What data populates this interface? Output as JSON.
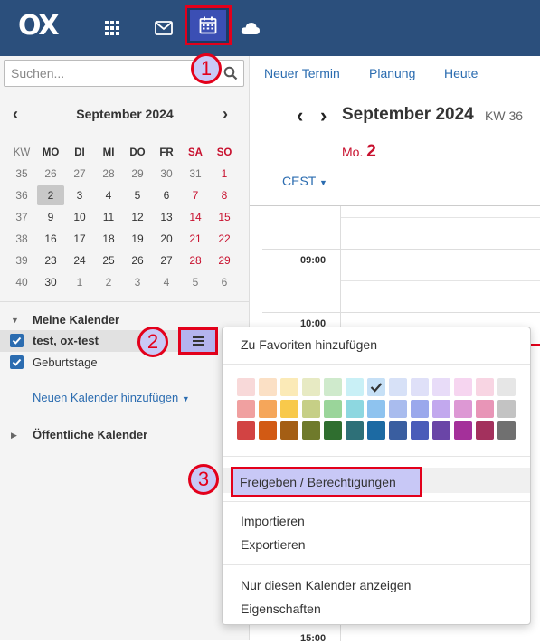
{
  "topbar": {
    "logo": "OX",
    "icons": [
      "apps-grid-icon",
      "mail-icon",
      "calendar-icon",
      "cloud-icon"
    ]
  },
  "markers": [
    "1",
    "2",
    "3"
  ],
  "search": {
    "placeholder": "Suchen..."
  },
  "mini_calendar": {
    "title": "September 2024",
    "headers": [
      "KW",
      "MO",
      "DI",
      "MI",
      "DO",
      "FR",
      "SA",
      "SO"
    ],
    "weeks": [
      [
        "35",
        "26",
        "27",
        "28",
        "29",
        "30",
        "31",
        "1"
      ],
      [
        "36",
        "2",
        "3",
        "4",
        "5",
        "6",
        "7",
        "8"
      ],
      [
        "37",
        "9",
        "10",
        "11",
        "12",
        "13",
        "14",
        "15"
      ],
      [
        "38",
        "16",
        "17",
        "18",
        "19",
        "20",
        "21",
        "22"
      ],
      [
        "39",
        "23",
        "24",
        "25",
        "26",
        "27",
        "28",
        "29"
      ],
      [
        "40",
        "30",
        "1",
        "2",
        "3",
        "4",
        "5",
        "6"
      ]
    ]
  },
  "calendars": {
    "my_title": "Meine Kalender",
    "items": [
      {
        "label": "test, ox-test",
        "checked": true
      },
      {
        "label": "Geburtstage",
        "checked": true
      }
    ],
    "add_link": "Neuen Kalender hinzufügen",
    "public_title": "Öffentliche Kalender"
  },
  "toolbar": {
    "new_appointment": "Neuer Termin",
    "planning": "Planung",
    "today": "Heute"
  },
  "view": {
    "month_title": "September 2024",
    "week": "KW 36",
    "day_prefix": "Mo.",
    "day_number": "2",
    "timezone": "CEST",
    "hours": [
      "09:00",
      "10:00",
      "15:00"
    ]
  },
  "dropdown": {
    "favorites": "Zu Favoriten hinzufügen",
    "share": "Freigeben / Berechtigungen",
    "import": "Importieren",
    "export": "Exportieren",
    "only_this": "Nur diesen Kalender anzeigen",
    "properties": "Eigenschaften",
    "colors": [
      [
        "#f8d9d9",
        "#fbe0c5",
        "#fbeab7",
        "#e7eac3",
        "#cfeacc",
        "#c9f0f6",
        "#c6e0f6",
        "#d7e1f7",
        "#dfe0f8",
        "#e8dcf8",
        "#f6d5f0",
        "#f8d5e3",
        "#e6e6e6"
      ],
      [
        "#f0a0a0",
        "#f5a65a",
        "#f8c94b",
        "#c6cf86",
        "#9ad59a",
        "#8dd7e0",
        "#8ec3ef",
        "#a9bcee",
        "#9aa8ec",
        "#c2a8ee",
        "#dd98d4",
        "#e895b7",
        "#c3c3c3"
      ],
      [
        "#d24343",
        "#d25a14",
        "#a45e14",
        "#6f7a2b",
        "#2f6e2f",
        "#2e7078",
        "#1c6aa3",
        "#3a5ea0",
        "#4a5cb9",
        "#6a45a7",
        "#a4309a",
        "#a3315d",
        "#707070"
      ]
    ],
    "selected_color": "#c6e0f6"
  }
}
